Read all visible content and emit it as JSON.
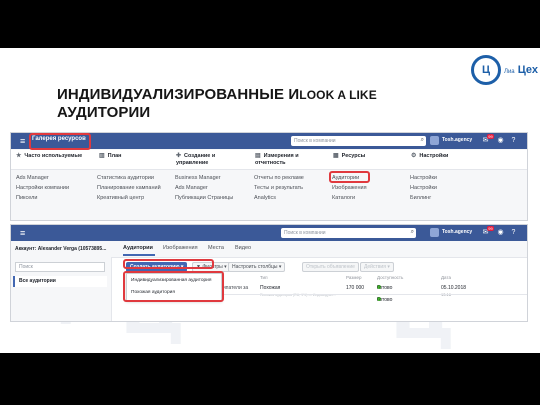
{
  "slide": {
    "title_part1": "ИНДИВИДУАЛИЗИРОВАННЫЕ И",
    "title_part2": "LOOK A LIKE",
    "title_line2": "АУДИТОРИИ",
    "logo_mark": "Ц",
    "logo_prefix": "Лиа",
    "logo_word": "Цех"
  },
  "shot1": {
    "topbar": {
      "title": "Галерея ресурсов",
      "search_placeholder": "Поиск в компании",
      "account": "Tosh.agency",
      "notif_count": "99"
    },
    "categories": [
      {
        "icon": "star-icon",
        "glyph": "★",
        "label": "Часто используемые"
      },
      {
        "icon": "bar-chart-icon",
        "glyph": "▥",
        "label": "План"
      },
      {
        "icon": "plus-icon",
        "glyph": "✚",
        "label": "Создание и управление"
      },
      {
        "icon": "chart-icon",
        "glyph": "▤",
        "label": "Измерения и отчетность"
      },
      {
        "icon": "grid-icon",
        "glyph": "▦",
        "label": "Ресурсы"
      },
      {
        "icon": "gear-icon",
        "glyph": "⚙",
        "label": "Настройки"
      }
    ],
    "columns": [
      [
        "Ads Manager",
        "Настройки компании",
        "Пиксели"
      ],
      [
        "Статистика аудитории",
        "Планирование кампаний",
        "Креативный центр"
      ],
      [
        "Business Manager",
        "Ads Manager",
        "Публикации Страницы"
      ],
      [
        "Отчеты по рекламе",
        "Тесты и результать",
        "Analytics"
      ],
      [
        "Аудитории",
        "Изображения",
        "Каталоги"
      ],
      [
        "Настройки",
        "Настройки",
        "Биллинг"
      ]
    ]
  },
  "shot2": {
    "topbar": {
      "search_placeholder": "Поиск в компании",
      "account": "Tosh.agency",
      "notif_count": "99"
    },
    "account_selector": "Аккаунт: Alexander Verga (10573895...",
    "side_search_placeholder": "Поиск",
    "side_active": "Все аудитории",
    "tabs": [
      "Аудитории",
      "Изображения",
      "Места",
      "Видео"
    ],
    "toolbar": {
      "create_label": "Создать аудиторию",
      "filters_label": "Фильтры",
      "columns_label": "Настроить столбцы",
      "share_label": "Открыть объявление",
      "actions_label": "Действия"
    },
    "dropdown_items": [
      "Индивидуализированная аудитория",
      "Похожая аудитория"
    ],
    "table_headers": [
      "Тип",
      "Размер",
      "Доступность",
      "Дата"
    ],
    "row": {
      "name_cut": "ипатели за",
      "type": "Похожая",
      "type_sub": "Похожая аудитория (RU, 1%) — Индивидуал...",
      "size": "170 000",
      "status": "Готово",
      "date": "05.10.2018",
      "time": "13:16"
    },
    "row2": {
      "status": "Готово"
    }
  },
  "colors": {
    "fb_blue": "#3b5998",
    "highlight": "#e0393e",
    "logo_blue": "#1d5fa8"
  }
}
